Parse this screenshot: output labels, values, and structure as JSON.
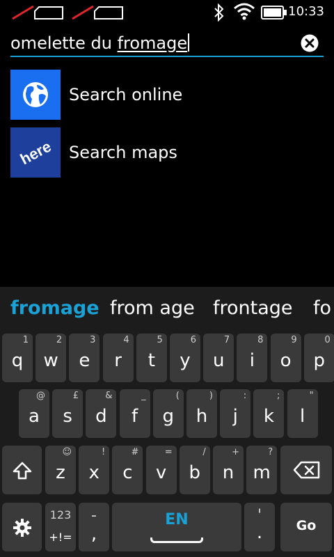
{
  "status_bar": {
    "time": "10:33",
    "icons": [
      "sim1-no-signal-icon",
      "sim2-no-signal-icon",
      "bluetooth-icon",
      "wifi-icon",
      "battery-icon"
    ]
  },
  "search": {
    "text_before": "omelette du ",
    "text_current_word": "fromage",
    "accent_color": "#1aa1d6"
  },
  "results": [
    {
      "label": "Search online",
      "icon": "globe-icon",
      "icon_bg": "#1a6ff0"
    },
    {
      "label": "Search maps",
      "icon": "here-maps-icon",
      "icon_bg": "#1e3f9c",
      "icon_text": "here"
    }
  ],
  "keyboard": {
    "suggestions": [
      "fromage",
      "from age",
      "frontage",
      "fo"
    ],
    "row1": [
      {
        "k": "q",
        "a": "1"
      },
      {
        "k": "w",
        "a": "2"
      },
      {
        "k": "e",
        "a": "3"
      },
      {
        "k": "r",
        "a": "4"
      },
      {
        "k": "t",
        "a": "5"
      },
      {
        "k": "y",
        "a": "6"
      },
      {
        "k": "u",
        "a": "7"
      },
      {
        "k": "i",
        "a": "8"
      },
      {
        "k": "o",
        "a": "9"
      },
      {
        "k": "p",
        "a": "0"
      }
    ],
    "row2": [
      {
        "k": "a",
        "a": "@"
      },
      {
        "k": "s",
        "a": "£"
      },
      {
        "k": "d",
        "a": "&"
      },
      {
        "k": "f",
        "a": "_"
      },
      {
        "k": "g",
        "a": "("
      },
      {
        "k": "h",
        "a": ")"
      },
      {
        "k": "j",
        "a": ":"
      },
      {
        "k": "k",
        "a": ";"
      },
      {
        "k": "l",
        "a": "\""
      }
    ],
    "row3": [
      {
        "k": "z",
        "a": "☺"
      },
      {
        "k": "x",
        "a": "!"
      },
      {
        "k": "c",
        "a": "#"
      },
      {
        "k": "v",
        "a": "="
      },
      {
        "k": "b",
        "a": "/"
      },
      {
        "k": "n",
        "a": "+"
      },
      {
        "k": "m",
        "a": "?"
      }
    ],
    "symbols_key": {
      "top": "123",
      "bottom": "+!="
    },
    "dash_comma_key": {
      "top": "-",
      "bottom": ","
    },
    "space_key_label": "EN",
    "quote_period_key": {
      "top": "'",
      "bottom": "."
    },
    "go_label": "Go"
  }
}
